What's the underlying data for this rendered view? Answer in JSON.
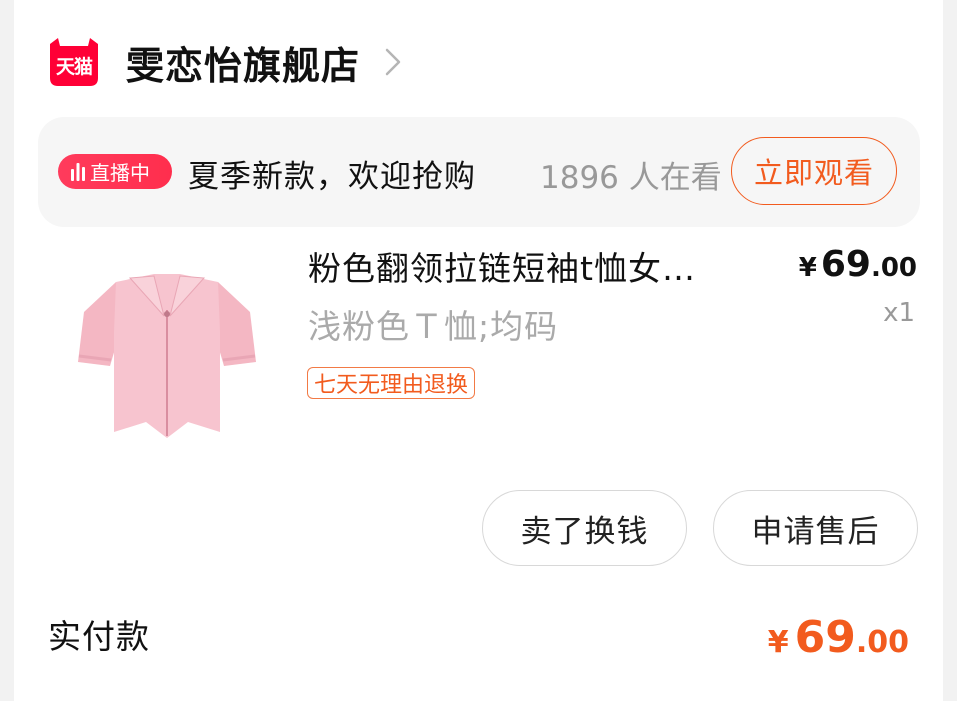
{
  "shop": {
    "badge": "天猫",
    "name": "雯恋怡旗舰店"
  },
  "live": {
    "badge": "直播中",
    "title": "夏季新款，欢迎抢购",
    "viewers": "1896 人在看",
    "watch_label": "立即观看"
  },
  "product": {
    "title": "粉色翻领拉链短袖t恤女…",
    "sku": "浅粉色Ｔ恤;均码",
    "tag": "七天无理由退换",
    "price_symbol": "¥",
    "price_int": "69",
    "price_dec": ".00",
    "quantity": "x1",
    "image": "pink-collar-zip-tshirt-image"
  },
  "actions": {
    "sell_label": "卖了换钱",
    "aftersale_label": "申请售后"
  },
  "total": {
    "label": "实付款",
    "symbol": "¥",
    "int": "69",
    "dec": ".00"
  },
  "colors": {
    "accent": "#f25b1e",
    "live_red": "#ff2e4d",
    "tmall_red": "#ff0036"
  }
}
